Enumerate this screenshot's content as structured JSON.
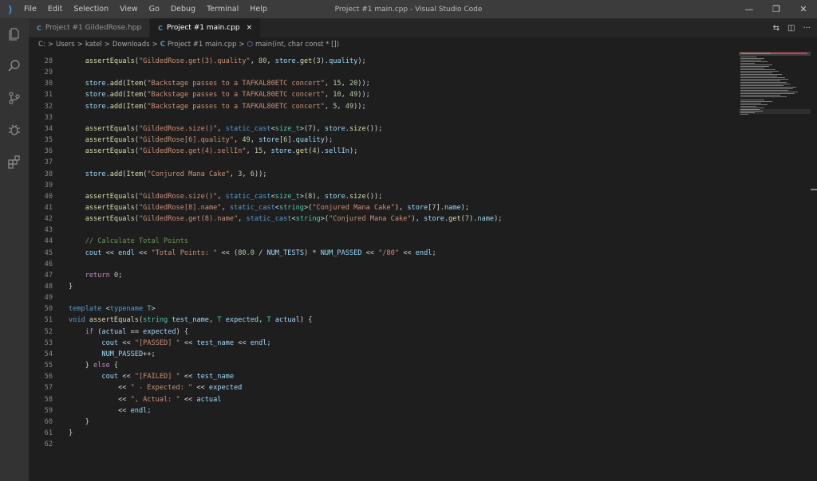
{
  "app": {
    "logo": "⟩",
    "menu": [
      "File",
      "Edit",
      "Selection",
      "View",
      "Go",
      "Debug",
      "Terminal",
      "Help"
    ],
    "window_title": "Project #1 main.cpp - Visual Studio Code",
    "controls": [
      "—",
      "❐",
      "✕"
    ]
  },
  "tabs": [
    {
      "icon": "C",
      "label": "Project #1 GildedRose.hpp",
      "active": false
    },
    {
      "icon": "C",
      "label": "Project #1 main.cpp",
      "active": true,
      "close": "×"
    }
  ],
  "tab_actions": [
    "⇆",
    "◫",
    "···"
  ],
  "breadcrumb": [
    "C:",
    ">",
    "Users",
    ">",
    "katel",
    ">",
    "Downloads",
    ">",
    "C",
    "Project #1 main.cpp",
    ">",
    "⬡",
    "main(int, char const * [])"
  ],
  "code": [
    {
      "n": "28",
      "t": [
        [
          "    ",
          ""
        ],
        [
          "assertEquals",
          "fn"
        ],
        [
          "(",
          ""
        ],
        [
          "\"GildedRose.get(3).quality\"",
          "str"
        ],
        [
          ", ",
          ""
        ],
        [
          "80",
          "num"
        ],
        [
          ", ",
          ""
        ],
        [
          "store",
          "var"
        ],
        [
          ".",
          ""
        ],
        [
          "get",
          "fn"
        ],
        [
          "(",
          ""
        ],
        [
          "3",
          "num"
        ],
        [
          ").",
          ""
        ],
        [
          "quality",
          "var"
        ],
        [
          ");",
          ""
        ]
      ]
    },
    {
      "n": "29",
      "t": []
    },
    {
      "n": "30",
      "t": [
        [
          "    ",
          ""
        ],
        [
          "store",
          "var"
        ],
        [
          ".",
          ""
        ],
        [
          "add",
          "fn"
        ],
        [
          "(",
          ""
        ],
        [
          "Item",
          "fn"
        ],
        [
          "(",
          ""
        ],
        [
          "\"Backstage passes to a TAFKAL80ETC concert\"",
          "str"
        ],
        [
          ", ",
          ""
        ],
        [
          "15",
          "num"
        ],
        [
          ", ",
          ""
        ],
        [
          "20",
          "num"
        ],
        [
          "));",
          ""
        ]
      ]
    },
    {
      "n": "31",
      "t": [
        [
          "    ",
          ""
        ],
        [
          "store",
          "var"
        ],
        [
          ".",
          ""
        ],
        [
          "add",
          "fn"
        ],
        [
          "(",
          ""
        ],
        [
          "Item",
          "fn"
        ],
        [
          "(",
          ""
        ],
        [
          "\"Backstage passes to a TAFKAL80ETC concert\"",
          "str"
        ],
        [
          ", ",
          ""
        ],
        [
          "10",
          "num"
        ],
        [
          ", ",
          ""
        ],
        [
          "49",
          "num"
        ],
        [
          "));",
          ""
        ]
      ]
    },
    {
      "n": "32",
      "t": [
        [
          "    ",
          ""
        ],
        [
          "store",
          "var"
        ],
        [
          ".",
          ""
        ],
        [
          "add",
          "fn"
        ],
        [
          "(",
          ""
        ],
        [
          "Item",
          "fn"
        ],
        [
          "(",
          ""
        ],
        [
          "\"Backstage passes to a TAFKAL80ETC concert\"",
          "str"
        ],
        [
          ", ",
          ""
        ],
        [
          "5",
          "num"
        ],
        [
          ", ",
          ""
        ],
        [
          "49",
          "num"
        ],
        [
          "));",
          ""
        ]
      ]
    },
    {
      "n": "33",
      "t": []
    },
    {
      "n": "34",
      "t": [
        [
          "    ",
          ""
        ],
        [
          "assertEquals",
          "fn"
        ],
        [
          "(",
          ""
        ],
        [
          "\"GildedRose.size()\"",
          "str"
        ],
        [
          ", ",
          ""
        ],
        [
          "static_cast",
          "kw"
        ],
        [
          "<",
          ""
        ],
        [
          "size_t",
          "typ"
        ],
        [
          ">(",
          ""
        ],
        [
          "7",
          "num"
        ],
        [
          "), ",
          ""
        ],
        [
          "store",
          "var"
        ],
        [
          ".",
          ""
        ],
        [
          "size",
          "fn"
        ],
        [
          "());",
          ""
        ]
      ]
    },
    {
      "n": "35",
      "t": [
        [
          "    ",
          ""
        ],
        [
          "assertEquals",
          "fn"
        ],
        [
          "(",
          ""
        ],
        [
          "\"GildedRose[6].quality\"",
          "str"
        ],
        [
          ", ",
          ""
        ],
        [
          "49",
          "num"
        ],
        [
          ", ",
          ""
        ],
        [
          "store",
          "var"
        ],
        [
          "[",
          ""
        ],
        [
          "6",
          "num"
        ],
        [
          "].",
          ""
        ],
        [
          "quality",
          "var"
        ],
        [
          ");",
          ""
        ]
      ]
    },
    {
      "n": "36",
      "t": [
        [
          "    ",
          ""
        ],
        [
          "assertEquals",
          "fn"
        ],
        [
          "(",
          ""
        ],
        [
          "\"GildedRose.get(4).sellIn\"",
          "str"
        ],
        [
          ", ",
          ""
        ],
        [
          "15",
          "num"
        ],
        [
          ", ",
          ""
        ],
        [
          "store",
          "var"
        ],
        [
          ".",
          ""
        ],
        [
          "get",
          "fn"
        ],
        [
          "(",
          ""
        ],
        [
          "4",
          "num"
        ],
        [
          ").",
          ""
        ],
        [
          "sellIn",
          "var"
        ],
        [
          ");",
          ""
        ]
      ]
    },
    {
      "n": "37",
      "t": []
    },
    {
      "n": "38",
      "t": [
        [
          "    ",
          ""
        ],
        [
          "store",
          "var"
        ],
        [
          ".",
          ""
        ],
        [
          "add",
          "fn"
        ],
        [
          "(",
          ""
        ],
        [
          "Item",
          "fn"
        ],
        [
          "(",
          ""
        ],
        [
          "\"Conjured Mana Cake\"",
          "str"
        ],
        [
          ", ",
          ""
        ],
        [
          "3",
          "num"
        ],
        [
          ", ",
          ""
        ],
        [
          "6",
          "num"
        ],
        [
          "));",
          ""
        ]
      ]
    },
    {
      "n": "39",
      "t": []
    },
    {
      "n": "40",
      "t": [
        [
          "    ",
          ""
        ],
        [
          "assertEquals",
          "fn"
        ],
        [
          "(",
          ""
        ],
        [
          "\"GildedRose.size()\"",
          "str"
        ],
        [
          ", ",
          ""
        ],
        [
          "static_cast",
          "kw"
        ],
        [
          "<",
          ""
        ],
        [
          "size_t",
          "typ"
        ],
        [
          ">(",
          ""
        ],
        [
          "8",
          "num"
        ],
        [
          "), ",
          ""
        ],
        [
          "store",
          "var"
        ],
        [
          ".",
          ""
        ],
        [
          "size",
          "fn"
        ],
        [
          "());",
          ""
        ]
      ]
    },
    {
      "n": "41",
      "t": [
        [
          "    ",
          ""
        ],
        [
          "assertEquals",
          "fn"
        ],
        [
          "(",
          ""
        ],
        [
          "\"GildedRose[8].name\"",
          "str"
        ],
        [
          ", ",
          ""
        ],
        [
          "static_cast",
          "kw"
        ],
        [
          "<",
          ""
        ],
        [
          "string",
          "typ"
        ],
        [
          ">(",
          ""
        ],
        [
          "\"Conjured Mana Cake\"",
          "str"
        ],
        [
          "), ",
          ""
        ],
        [
          "store",
          "var"
        ],
        [
          "[",
          ""
        ],
        [
          "7",
          "num"
        ],
        [
          "].",
          ""
        ],
        [
          "name",
          "var"
        ],
        [
          ");",
          ""
        ]
      ]
    },
    {
      "n": "42",
      "t": [
        [
          "    ",
          ""
        ],
        [
          "assertEquals",
          "fn"
        ],
        [
          "(",
          ""
        ],
        [
          "\"GildedRose.get(8).name\"",
          "str"
        ],
        [
          ", ",
          ""
        ],
        [
          "static_cast",
          "kw"
        ],
        [
          "<",
          ""
        ],
        [
          "string",
          "typ"
        ],
        [
          ">(",
          ""
        ],
        [
          "\"Conjured Mana Cake\"",
          "str"
        ],
        [
          "), ",
          ""
        ],
        [
          "store",
          "var"
        ],
        [
          ".",
          ""
        ],
        [
          "get",
          "fn"
        ],
        [
          "(",
          ""
        ],
        [
          "7",
          "num"
        ],
        [
          ").",
          ""
        ],
        [
          "name",
          "var"
        ],
        [
          ");",
          ""
        ]
      ]
    },
    {
      "n": "43",
      "t": []
    },
    {
      "n": "44",
      "t": [
        [
          "    ",
          ""
        ],
        [
          "// Calculate Total Points",
          "cmt"
        ]
      ]
    },
    {
      "n": "45",
      "t": [
        [
          "    ",
          ""
        ],
        [
          "cout",
          "var"
        ],
        [
          " << ",
          ""
        ],
        [
          "endl",
          "var"
        ],
        [
          " << ",
          ""
        ],
        [
          "\"Total Points: \"",
          "str"
        ],
        [
          " << (",
          ""
        ],
        [
          "80.0",
          "num"
        ],
        [
          " / ",
          ""
        ],
        [
          "NUM_TESTS",
          "var"
        ],
        [
          ") * ",
          ""
        ],
        [
          "NUM_PASSED",
          "var"
        ],
        [
          " << ",
          ""
        ],
        [
          "\"/80\"",
          "str"
        ],
        [
          " << ",
          ""
        ],
        [
          "endl",
          "var"
        ],
        [
          ";",
          ""
        ]
      ]
    },
    {
      "n": "46",
      "t": []
    },
    {
      "n": "47",
      "t": [
        [
          "    ",
          ""
        ],
        [
          "return",
          "ctl"
        ],
        [
          " ",
          ""
        ],
        [
          "0",
          "num"
        ],
        [
          ";",
          ""
        ]
      ]
    },
    {
      "n": "48",
      "t": [
        [
          "}",
          ""
        ]
      ]
    },
    {
      "n": "49",
      "t": []
    },
    {
      "n": "50",
      "t": [
        [
          "template",
          "kw"
        ],
        [
          " <",
          ""
        ],
        [
          "typename",
          "kw"
        ],
        [
          " ",
          ""
        ],
        [
          "T",
          "typ"
        ],
        [
          ">",
          ""
        ]
      ]
    },
    {
      "n": "51",
      "t": [
        [
          "void",
          "kw"
        ],
        [
          " ",
          ""
        ],
        [
          "assertEquals",
          "fn"
        ],
        [
          "(",
          ""
        ],
        [
          "string",
          "typ"
        ],
        [
          " ",
          ""
        ],
        [
          "test_name",
          "var"
        ],
        [
          ", ",
          ""
        ],
        [
          "T",
          "typ"
        ],
        [
          " ",
          ""
        ],
        [
          "expected",
          "var"
        ],
        [
          ", ",
          ""
        ],
        [
          "T",
          "typ"
        ],
        [
          " ",
          ""
        ],
        [
          "actual",
          "var"
        ],
        [
          ") {",
          ""
        ]
      ]
    },
    {
      "n": "52",
      "t": [
        [
          "    ",
          ""
        ],
        [
          "if",
          "ctl"
        ],
        [
          " (",
          ""
        ],
        [
          "actual",
          "var"
        ],
        [
          " == ",
          ""
        ],
        [
          "expected",
          "var"
        ],
        [
          ") {",
          ""
        ]
      ]
    },
    {
      "n": "53",
      "t": [
        [
          "        ",
          ""
        ],
        [
          "cout",
          "var"
        ],
        [
          " << ",
          ""
        ],
        [
          "\"[PASSED] \"",
          "str"
        ],
        [
          " << ",
          ""
        ],
        [
          "test_name",
          "var"
        ],
        [
          " << ",
          ""
        ],
        [
          "endl",
          "var"
        ],
        [
          ";",
          ""
        ]
      ]
    },
    {
      "n": "54",
      "t": [
        [
          "        ",
          ""
        ],
        [
          "NUM_PASSED",
          "var"
        ],
        [
          "++;",
          ""
        ]
      ]
    },
    {
      "n": "55",
      "t": [
        [
          "    } ",
          ""
        ],
        [
          "else",
          "ctl"
        ],
        [
          " {",
          ""
        ]
      ]
    },
    {
      "n": "56",
      "t": [
        [
          "        ",
          ""
        ],
        [
          "cout",
          "var"
        ],
        [
          " << ",
          ""
        ],
        [
          "\"[FAILED] \"",
          "str"
        ],
        [
          " << ",
          ""
        ],
        [
          "test_name",
          "var"
        ]
      ]
    },
    {
      "n": "57",
      "t": [
        [
          "            << ",
          ""
        ],
        [
          "\" - Expected: \"",
          "str"
        ],
        [
          " << ",
          ""
        ],
        [
          "expected",
          "var"
        ]
      ]
    },
    {
      "n": "58",
      "t": [
        [
          "            << ",
          ""
        ],
        [
          "\", Actual: \"",
          "str"
        ],
        [
          " << ",
          ""
        ],
        [
          "actual",
          "var"
        ]
      ]
    },
    {
      "n": "59",
      "t": [
        [
          "            << ",
          ""
        ],
        [
          "endl",
          "var"
        ],
        [
          ";",
          ""
        ]
      ]
    },
    {
      "n": "60",
      "t": [
        [
          "    }",
          ""
        ]
      ]
    },
    {
      "n": "61",
      "t": [
        [
          "}",
          ""
        ]
      ]
    },
    {
      "n": "62",
      "t": []
    }
  ],
  "colors": {
    "accent": "#007acc",
    "editor_bg": "#1e1e1e",
    "titlebar_bg": "#3c3c3c"
  }
}
